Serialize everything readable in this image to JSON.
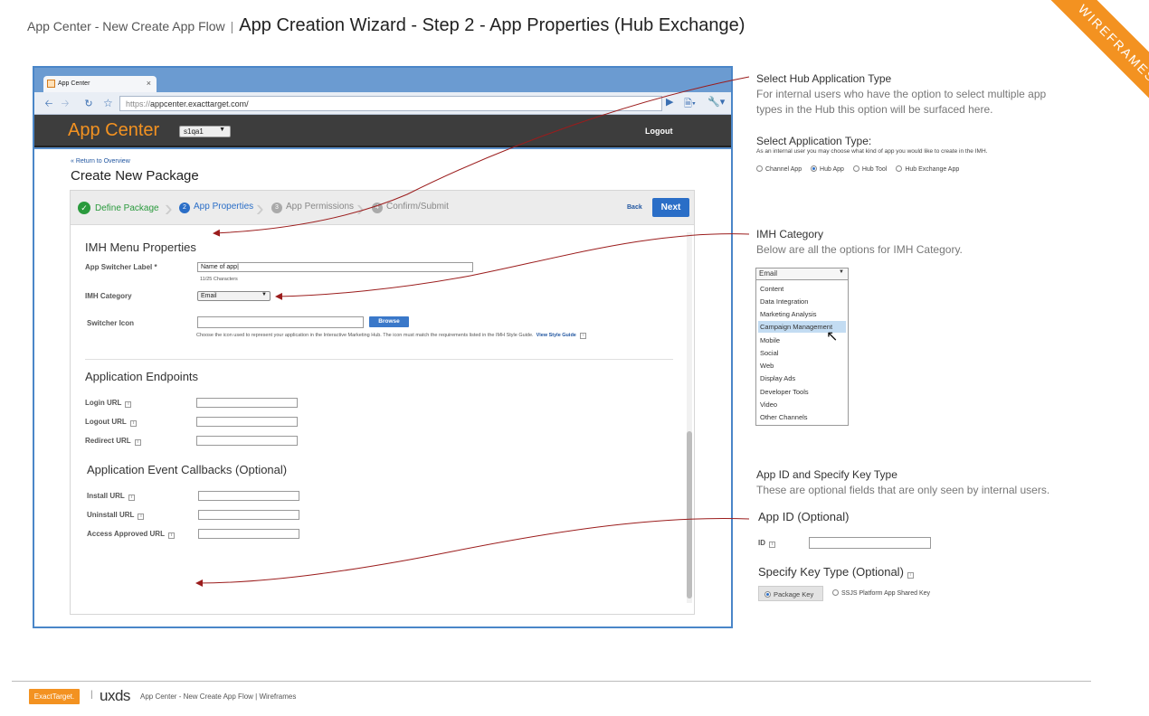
{
  "header": {
    "subtitle": "App Center - New Create App Flow",
    "separator": "|",
    "title": "App Creation Wizard - Step 2 - App Properties (Hub Exchange)",
    "banner": "WIREFRAMES"
  },
  "browser": {
    "tab_title": "App Center",
    "tab_close": "×",
    "url_scheme": "https://",
    "url_host": "appcenter.exacttarget.com/"
  },
  "appbar": {
    "logo": "App Center",
    "account_select": "s1qa1",
    "logout": "Logout"
  },
  "page": {
    "return_link": "« Return to Overview",
    "title": "Create New Package",
    "steps": [
      {
        "label": "Define Package",
        "state": "complete",
        "num": ""
      },
      {
        "label": "App Properties",
        "state": "current",
        "num": "2"
      },
      {
        "label": "App Permissions",
        "state": "pending",
        "num": "3"
      },
      {
        "label": "Confirm/Submit",
        "state": "pending",
        "num": "4"
      }
    ],
    "back": "Back",
    "next": "Next",
    "imh_section": "IMH Menu Properties",
    "app_switcher_label": "App Switcher Label *",
    "app_switcher_value": "Name of app|",
    "char_count": "11/25 Characters",
    "imh_category_label": "IMH Category",
    "imh_category_value": "Email",
    "switcher_icon_label": "Switcher Icon",
    "browse": "Browse",
    "icon_help": "Choose the icon used to represent your application in the Interactive Marketing Hub. The icon must match the requirements listed in the IMH Style Guide.",
    "style_guide_link": "View Style Guide",
    "endpoints_section": "Application Endpoints",
    "login_url": "Login URL",
    "logout_url": "Logout URL",
    "redirect_url": "Redirect URL",
    "callbacks_section": "Application Event Callbacks (Optional)",
    "install_url": "Install URL",
    "uninstall_url": "Uninstall URL",
    "access_approved_url": "Access Approved URL"
  },
  "notes": {
    "hub_type_title": "Select Hub Application Type",
    "hub_type_desc": "For internal users who have the option to select multiple app types in the Hub this option will be surfaced here.",
    "app_type_title": "Select Application Type:",
    "app_type_desc": "As an internal user you may choose what kind of app you would like to create in the IMH.",
    "app_types": [
      "Channel App",
      "Hub App",
      "Hub Tool",
      "Hub Exchange App"
    ],
    "app_type_selected": "Hub App",
    "imh_title": "IMH Category",
    "imh_desc": "Below are all the options for IMH Category.",
    "imh_dropdown_value": "Email",
    "imh_options": [
      "Content",
      "Data Integration",
      "Marketing Analysis",
      "Campaign Management",
      "Mobile",
      "Social",
      "Web",
      "Display Ads",
      "Developer Tools",
      "Video",
      "Other Channels"
    ],
    "imh_highlighted": "Campaign Management",
    "appid_title": "App ID and Specify Key Type",
    "appid_desc": "These are optional fields that are only seen by internal users.",
    "appid_heading": "App ID (Optional)",
    "id_label": "ID",
    "key_type_heading": "Specify Key Type (Optional)",
    "key_options": [
      "Package Key",
      "SSJS Platform App Shared Key"
    ]
  },
  "footer": {
    "logo": "ExactTarget.",
    "bar": "|",
    "brand": "uxds",
    "text": "App Center - New Create App Flow  |  Wireframes"
  },
  "colors": {
    "accent_orange": "#f39221",
    "browser_blue": "#4a86c8",
    "link_blue": "#2156a0",
    "button_blue": "#2a6ec7",
    "step_complete": "#2a9a3d",
    "arrow_red": "#9b1c1c"
  }
}
